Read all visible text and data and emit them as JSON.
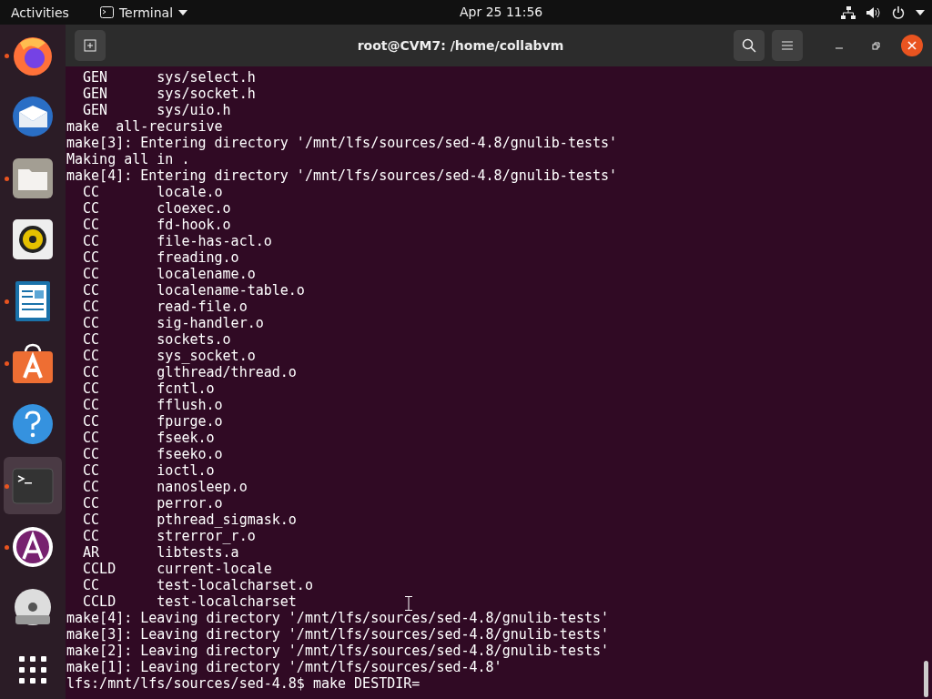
{
  "top_bar": {
    "activities": "Activities",
    "app_menu": "Terminal",
    "clock": "Apr 25  11:56"
  },
  "dock": [
    {
      "kind": "browser",
      "running": true,
      "selected": false
    },
    {
      "kind": "mail",
      "running": false,
      "selected": false
    },
    {
      "kind": "files",
      "running": true,
      "selected": false
    },
    {
      "kind": "music",
      "running": false,
      "selected": false
    },
    {
      "kind": "document",
      "running": true,
      "selected": false
    },
    {
      "kind": "store",
      "running": true,
      "selected": false
    },
    {
      "kind": "help",
      "running": false,
      "selected": false
    },
    {
      "kind": "terminal",
      "running": true,
      "selected": true
    },
    {
      "kind": "software",
      "running": true,
      "selected": false
    },
    {
      "kind": "disc",
      "running": false,
      "selected": false
    },
    {
      "kind": "apps",
      "running": false,
      "selected": false
    }
  ],
  "terminal": {
    "title": "root@CVM7: /home/collabvm",
    "lines": [
      "  GEN      sys/select.h",
      "  GEN      sys/socket.h",
      "  GEN      sys/uio.h",
      "make  all-recursive",
      "make[3]: Entering directory '/mnt/lfs/sources/sed-4.8/gnulib-tests'",
      "Making all in .",
      "make[4]: Entering directory '/mnt/lfs/sources/sed-4.8/gnulib-tests'",
      "  CC       locale.o",
      "  CC       cloexec.o",
      "  CC       fd-hook.o",
      "  CC       file-has-acl.o",
      "  CC       freading.o",
      "  CC       localename.o",
      "  CC       localename-table.o",
      "  CC       read-file.o",
      "  CC       sig-handler.o",
      "  CC       sockets.o",
      "  CC       sys_socket.o",
      "  CC       glthread/thread.o",
      "  CC       fcntl.o",
      "  CC       fflush.o",
      "  CC       fpurge.o",
      "  CC       fseek.o",
      "  CC       fseeko.o",
      "  CC       ioctl.o",
      "  CC       nanosleep.o",
      "  CC       perror.o",
      "  CC       pthread_sigmask.o",
      "  CC       strerror_r.o",
      "  AR       libtests.a",
      "  CCLD     current-locale",
      "  CC       test-localcharset.o",
      "  CCLD     test-localcharset",
      "make[4]: Leaving directory '/mnt/lfs/sources/sed-4.8/gnulib-tests'",
      "make[3]: Leaving directory '/mnt/lfs/sources/sed-4.8/gnulib-tests'",
      "make[2]: Leaving directory '/mnt/lfs/sources/sed-4.8/gnulib-tests'",
      "make[1]: Leaving directory '/mnt/lfs/sources/sed-4.8'",
      "lfs:/mnt/lfs/sources/sed-4.8$ make DESTDIR="
    ]
  }
}
